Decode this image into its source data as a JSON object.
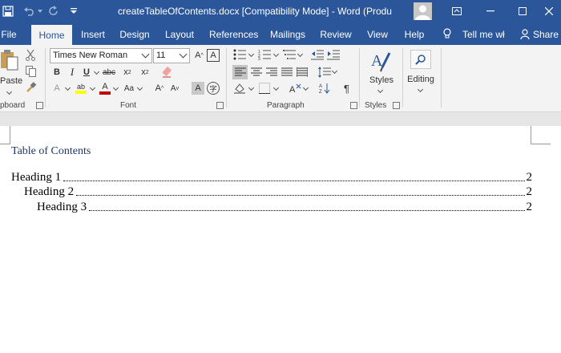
{
  "titlebar": {
    "title": "createTableOfContents.docx [Compatibility Mode]  -  Word (Produ",
    "color": "#2b579a"
  },
  "tabs": [
    {
      "label": "File"
    },
    {
      "label": "Home",
      "active": true
    },
    {
      "label": "Insert"
    },
    {
      "label": "Design"
    },
    {
      "label": "Layout"
    },
    {
      "label": "References"
    },
    {
      "label": "Mailings"
    },
    {
      "label": "Review"
    },
    {
      "label": "View"
    },
    {
      "label": "Help"
    }
  ],
  "tell_me": "Tell me wł",
  "share": "Share",
  "ribbon": {
    "clipboard": {
      "paste_label": "Paste",
      "group_label": "pboard"
    },
    "font": {
      "font_name": "Times New Roman",
      "font_size": "11",
      "group_label": "Font"
    },
    "paragraph": {
      "group_label": "Paragraph"
    },
    "styles": {
      "button_label": "Styles",
      "group_label": "Styles"
    },
    "editing": {
      "button_label": "Editing"
    }
  },
  "document": {
    "toc_title": "Table of Contents",
    "entries": [
      {
        "text": "Heading 1",
        "page": "2"
      },
      {
        "text": "Heading 2",
        "page": "2"
      },
      {
        "text": "Heading 3",
        "page": "2"
      }
    ]
  }
}
